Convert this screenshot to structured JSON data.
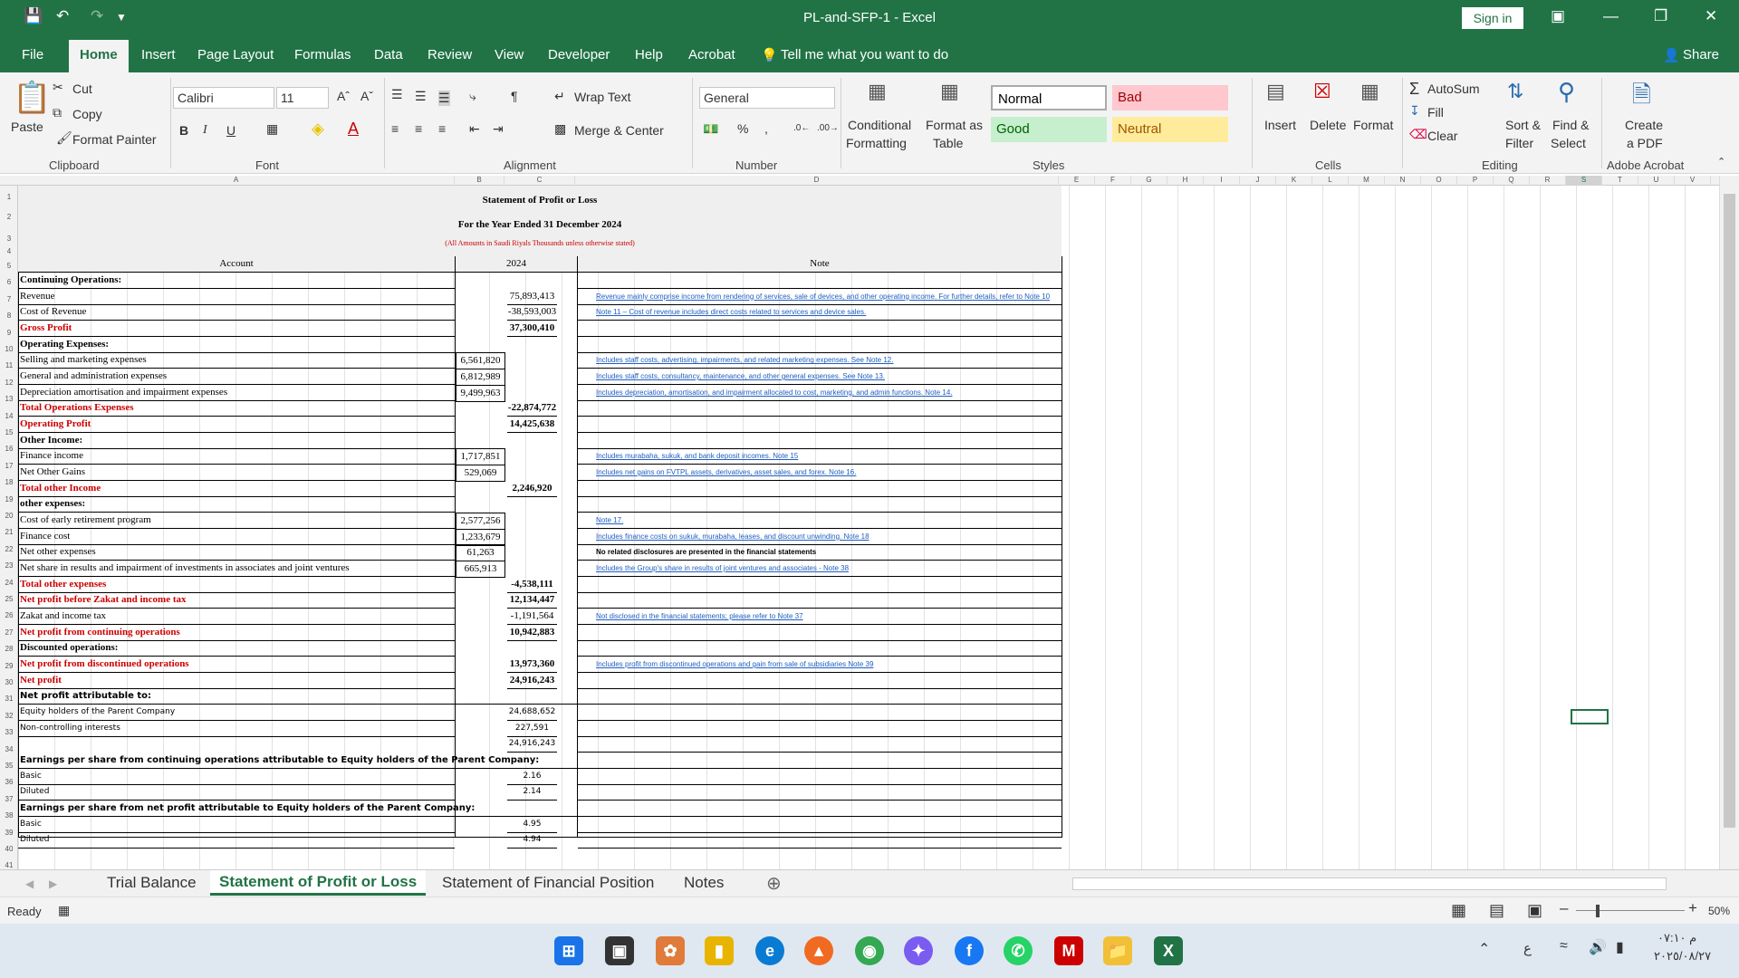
{
  "window": {
    "title": "PL-and-SFP-1  -  Excel",
    "signin": "Sign in"
  },
  "ribbon_tabs": [
    "File",
    "Home",
    "Insert",
    "Page Layout",
    "Formulas",
    "Data",
    "Review",
    "View",
    "Developer",
    "Help",
    "Acrobat"
  ],
  "tell_me": "Tell me what you want to do",
  "share": "Share",
  "clipboard": {
    "paste": "Paste",
    "cut": "Cut",
    "copy": "Copy",
    "format_painter": "Format Painter",
    "label": "Clipboard"
  },
  "font": {
    "name": "Calibri",
    "size": "11",
    "label": "Font"
  },
  "alignment": {
    "wrap": "Wrap Text",
    "merge": "Merge & Center",
    "label": "Alignment"
  },
  "number": {
    "format": "General",
    "label": "Number"
  },
  "styles": {
    "cond1": "Conditional",
    "cond2": "Formatting",
    "fmt1": "Format as",
    "fmt2": "Table",
    "normal": "Normal",
    "bad": "Bad",
    "good": "Good",
    "neutral": "Neutral",
    "label": "Styles"
  },
  "cells": {
    "insert": "Insert",
    "delete": "Delete",
    "format": "Format",
    "label": "Cells"
  },
  "editing": {
    "autosum": "AutoSum",
    "fill": "Fill",
    "clear": "Clear",
    "sort1": "Sort &",
    "sort2": "Filter",
    "find1": "Find &",
    "find2": "Select",
    "label": "Editing"
  },
  "acrobat": {
    "create1": "Create",
    "create2": "a PDF",
    "label": "Adobe Acrobat"
  },
  "columns": [
    "A",
    "B",
    "C",
    "D",
    "E",
    "F",
    "G",
    "H",
    "I",
    "J",
    "K",
    "L",
    "M",
    "N",
    "O",
    "P",
    "Q",
    "R",
    "S",
    "T",
    "U",
    "V"
  ],
  "sheet": {
    "title": "Statement of Profit or Loss",
    "subtitle": "For the Year Ended 31 December 2024",
    "amounts_note": "(All Amounts in Saudi Riyals Thousands unless otherwise stated)",
    "hdr_account": "Account",
    "hdr_year": "2024",
    "hdr_note": "Note",
    "rows": [
      {
        "r": 5,
        "a": "Continuing Operations:",
        "s": "h"
      },
      {
        "r": 6,
        "a": "Revenue",
        "c": "75,893,413",
        "n": "Revenue mainly comprise income from rendering of services, sale of devices, and other operating income. For further details, refer to Note 10"
      },
      {
        "r": 7,
        "a": "Cost of Revenue",
        "c": "-38,593,003",
        "n": "Note 11 – Cost of revenue includes direct costs related to services and device sales."
      },
      {
        "r": 8,
        "a": "Gross Profit",
        "c": "37,300,410",
        "s": "t"
      },
      {
        "r": 9,
        "a": "Operating Expenses:",
        "s": "h"
      },
      {
        "r": 10,
        "a": "Selling and marketing expenses",
        "b": "6,561,820",
        "n": "Includes staff costs, advertising, impairments, and related marketing expenses. See Note 12."
      },
      {
        "r": 11,
        "a": "General and administration expenses",
        "b": "6,812,989",
        "n": "Includes staff costs, consultancy, maintenance, and other general expenses. See Note 13."
      },
      {
        "r": 12,
        "a": "Depreciation amortisation and impairment expenses",
        "b": "9,499,963",
        "n": " Includes depreciation, amortisation, and impairment allocated to cost, marketing, and admin functions. Note 14."
      },
      {
        "r": 13,
        "a": "Total Operations Expenses",
        "c": "-22,874,772",
        "s": "t"
      },
      {
        "r": 14,
        "a": "Operating Profit",
        "c": "14,425,638",
        "s": "t"
      },
      {
        "r": 15,
        "a": "Other Income:",
        "s": "h"
      },
      {
        "r": 16,
        "a": "Finance income",
        "b": "1,717,851",
        "n": "Includes murabaha, sukuk, and bank deposit incomes. Note 15"
      },
      {
        "r": 17,
        "a": "Net Other Gains",
        "b": "529,069",
        "n": "Includes net gains on FVTPL assets, derivatives, asset sales, and forex. Note 16."
      },
      {
        "r": 18,
        "a": "Total other Income",
        "c": "2,246,920",
        "s": "t"
      },
      {
        "r": 19,
        "a": "other expenses:",
        "s": "h"
      },
      {
        "r": 20,
        "a": "Cost of early retirement program",
        "b": "2,577,256",
        "n": "Note 17."
      },
      {
        "r": 21,
        "a": "Finance cost",
        "b": "1,233,679",
        "n": "Includes finance costs on sukuk, murabaha, leases, and discount unwinding. Note 18"
      },
      {
        "r": 22,
        "a": "Net other expenses",
        "b": "61,263",
        "n": "No related disclosures are presented in the financial statements",
        "nb": true
      },
      {
        "r": 23,
        "a": "Net share in results and impairment of investments in associates and joint ventures",
        "b": "665,913",
        "n": "Includes the Group's share in results of joint ventures and associates - Note 38"
      },
      {
        "r": 24,
        "a": "Total other expenses",
        "c": "-4,538,111",
        "s": "t"
      },
      {
        "r": 25,
        "a": "Net profit before Zakat and income tax",
        "c": "12,134,447",
        "s": "t"
      },
      {
        "r": 26,
        "a": "Zakat and income tax",
        "c": "-1,191,564",
        "n": "Not disclosed in the financial statements; please refer to Note 37"
      },
      {
        "r": 27,
        "a": "Net profit from continuing operations",
        "c": "10,942,883",
        "s": "t"
      },
      {
        "r": 28,
        "a": "Discounted operations:",
        "s": "h"
      },
      {
        "r": 29,
        "a": "Net profit from discontinued operations",
        "c": "13,973,360",
        "s": "t",
        "n": "Includes profit from discontinued operations and gain from sale of subsidiaries Note 39"
      },
      {
        "r": 30,
        "a": "Net profit",
        "c": "24,916,243",
        "s": "t"
      },
      {
        "r": 31,
        "a": "Net profit attributable to:",
        "s": "hs"
      },
      {
        "r": 32,
        "a": "Equity holders of the Parent Company",
        "c": "24,688,652",
        "s": "s"
      },
      {
        "r": 33,
        "a": "Non-controlling interests",
        "c": "227,591",
        "s": "s"
      },
      {
        "r": 34,
        "a": "",
        "c": "24,916,243",
        "s": "s"
      },
      {
        "r": 35,
        "a": "Earnings per share from continuing operations attributable to Equity holders of the Parent Company:",
        "s": "hs"
      },
      {
        "r": 36,
        "a": "Basic",
        "c": "2.16",
        "s": "s"
      },
      {
        "r": 37,
        "a": "Diluted",
        "c": "2.14",
        "s": "s"
      },
      {
        "r": 38,
        "a": "Earnings per share from net profit  attributable to Equity holders of the Parent Company:",
        "s": "hs"
      },
      {
        "r": 39,
        "a": "Basic",
        "c": "4.95",
        "s": "s"
      },
      {
        "r": 40,
        "a": "Diluted",
        "c": "4.94",
        "s": "s"
      }
    ]
  },
  "sheet_tabs": [
    "Trial Balance",
    "Statement of Profit or Loss",
    "Statement of Financial Position",
    "Notes"
  ],
  "status": {
    "ready": "Ready",
    "zoom": "50%"
  },
  "clock": {
    "time": "م ٠٧:١٠",
    "date": "٢٠٢٥/٠٨/٢٧",
    "lang": "ع"
  }
}
